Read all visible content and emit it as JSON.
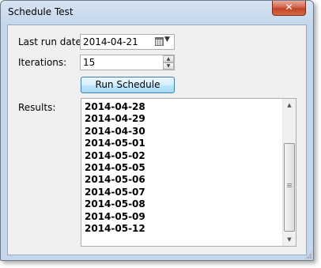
{
  "window": {
    "title": "Schedule Test",
    "close_glyph": "✕"
  },
  "form": {
    "last_run_label": "Last run date:",
    "last_run_value": "2014-04-21",
    "iterations_label": "Iterations:",
    "iterations_value": "15",
    "run_button": "Run Schedule",
    "results_label": "Results:"
  },
  "results": [
    "2014-04-28",
    "2014-04-29",
    "2014-04-30",
    "2014-05-01",
    "2014-05-02",
    "2014-05-05",
    "2014-05-06",
    "2014-05-07",
    "2014-05-08",
    "2014-05-09",
    "2014-05-12"
  ],
  "icons": {
    "calendar": "calendar-icon",
    "dropdown": "chevron-down-icon",
    "spin_up": "▲",
    "spin_down": "▼",
    "scroll_up": "▲",
    "scroll_down": "▼"
  }
}
